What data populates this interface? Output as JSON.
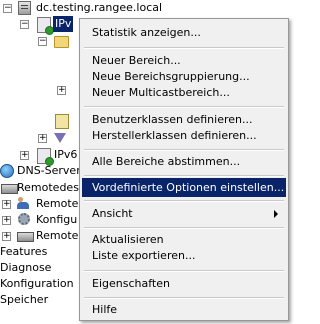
{
  "tree": {
    "root_label": "dc.testing.rangee.local",
    "ipv4_label": "IPv",
    "ipv6_label": "IPv6",
    "dns_label": "DNS-Server",
    "remotedesk_label": "Remotedesl",
    "remote1_label": "Remote",
    "config_label": "Konfigu",
    "remote2_label": "Remote",
    "features_label": "Features",
    "diagnose_label": "Diagnose",
    "konfiguration_label": "Konfiguration",
    "speicher_label": "Speicher",
    "collapse_glyph": "−",
    "expand_glyph": "+"
  },
  "context_menu": {
    "items": [
      "Statistik anzeigen...",
      "Neuer Bereich...",
      "Neue Bereichsgruppierung...",
      "Neuer Multicastbereich...",
      "Benutzerklassen definieren...",
      "Herstellerklassen definieren...",
      "Alle Bereiche abstimmen...",
      "Vordefinierte Optionen einstellen...",
      "Ansicht",
      "Aktualisieren",
      "Liste exportieren...",
      "Eigenschaften",
      "Hilfe"
    ],
    "highlighted": "Vordefinierte Optionen einstellen...",
    "submenu_item": "Ansicht"
  },
  "colors": {
    "highlight": "#0a246a",
    "menu_bg": "#f0f0f0",
    "status_ok": "#2c9b2c"
  },
  "icons": [
    "server-icon",
    "folder-icon",
    "dhcp-icon",
    "note-icon",
    "filter-icon",
    "dns-icon",
    "people-icon",
    "gear-icon",
    "rack-icon",
    "submenu-arrow-icon"
  ]
}
